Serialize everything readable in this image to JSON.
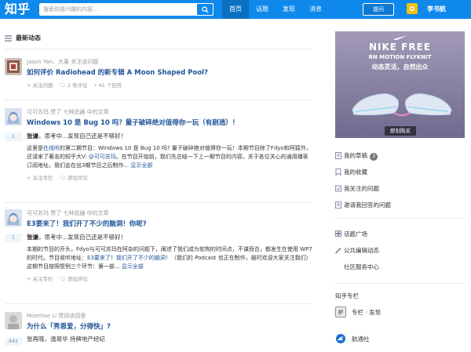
{
  "header": {
    "logo": "知乎",
    "search_placeholder": "搜索你感兴趣的内容...",
    "nav": [
      "首页",
      "话题",
      "发现",
      "消息"
    ],
    "ask_label": "提问",
    "user_name": "李书航"
  },
  "feed": {
    "title": "最新动态",
    "items": [
      {
        "meta": "Jason Yan、大果 关注该问题",
        "title": "如何评价 Radiohead 的新专辑 A Moon Shaped Pool?",
        "actions": [
          "+ 关注问题",
          "🗨 2 条评论",
          "• 41 个回答"
        ]
      },
      {
        "meta": "可可苏玛 赞了 七种武器 中的文章",
        "title": "Windows 10 是 Bug 10 吗？量子破碎绝对值得你一玩（有剧透）！",
        "count": "1",
        "author": "张谦",
        "author_desc": "，思考中...发现自己还是不够好！",
        "excerpt_1": "这里是",
        "excerpt_link1": "在线听",
        "excerpt_2": "的第二期节目：Windows 10 是 Bug 10 吗? 量子破碎绝对值得你一玩！本期节目除了Fdyo和阿猿外，还请来了著名的知乎大V: ",
        "excerpt_link2": "@可可苏玛",
        "excerpt_3": "。在节目开始前，我们先总结一下上一期节目的内容。关于各位关心的通用播客订阅地址，我们会在出3期节目之后制作...",
        "more": "显示全部",
        "actions": [
          "+ 关注专栏",
          "🗨 添加评论"
        ]
      },
      {
        "meta": "可可苏玛 赞了 七种武器 中的文章",
        "title": "E3要来了！我们开了不少的脑洞！你呢?",
        "count": "1",
        "author": "张谦",
        "author_desc": "，思考中...发现自己还是不够好！",
        "excerpt_1": "本期的节目的开头，Fdyo与可可苏玛在阿杂的问题下，阐述了我们成为软狗的时间点，不谋而合，都发生在使用 WP7 的时代。节目收听地址：",
        "excerpt_link1": "E3要来了！我们开了不少的脑洞！",
        "excerpt_2": "（我们的 Podcast 也正在制作，届时欢迎大家关注我们）这期节目按照惯例三个环节：第一部...",
        "more": "显示全部",
        "actions": [
          "+ 关注专栏",
          "🗨 添加评论"
        ]
      },
      {
        "meta": "Moemoe Li 赞同该回答",
        "title": "为什么「秀恩爱，分得快」?",
        "count": "442",
        "author_line": "张再晓，温哥华 持牌地产经纪"
      }
    ]
  },
  "sidebar": {
    "ad": {
      "title": "NIKE FREE",
      "subtitle": "RN MOTION FLYKNIT",
      "tagline": "动态灵活，自然出众",
      "button": "即刻购买",
      "bg_color": "#8c85a8"
    },
    "list1": [
      {
        "label": "我的草稿",
        "badge": "3"
      },
      {
        "label": "我的收藏"
      },
      {
        "label": "我关注的问题"
      },
      {
        "label": "邀请我回答的问题"
      }
    ],
    "list2": [
      {
        "label": "话题广场"
      },
      {
        "label": "公共编辑动态"
      },
      {
        "label": "社区服务中心"
      }
    ],
    "columns_title": "知乎专栏",
    "columns": [
      {
        "label": "专栏 · 发现"
      },
      {
        "label": "航通社"
      }
    ]
  },
  "colors": {
    "brand": "#0f88eb",
    "link": "#225599",
    "meta": "#999999"
  }
}
